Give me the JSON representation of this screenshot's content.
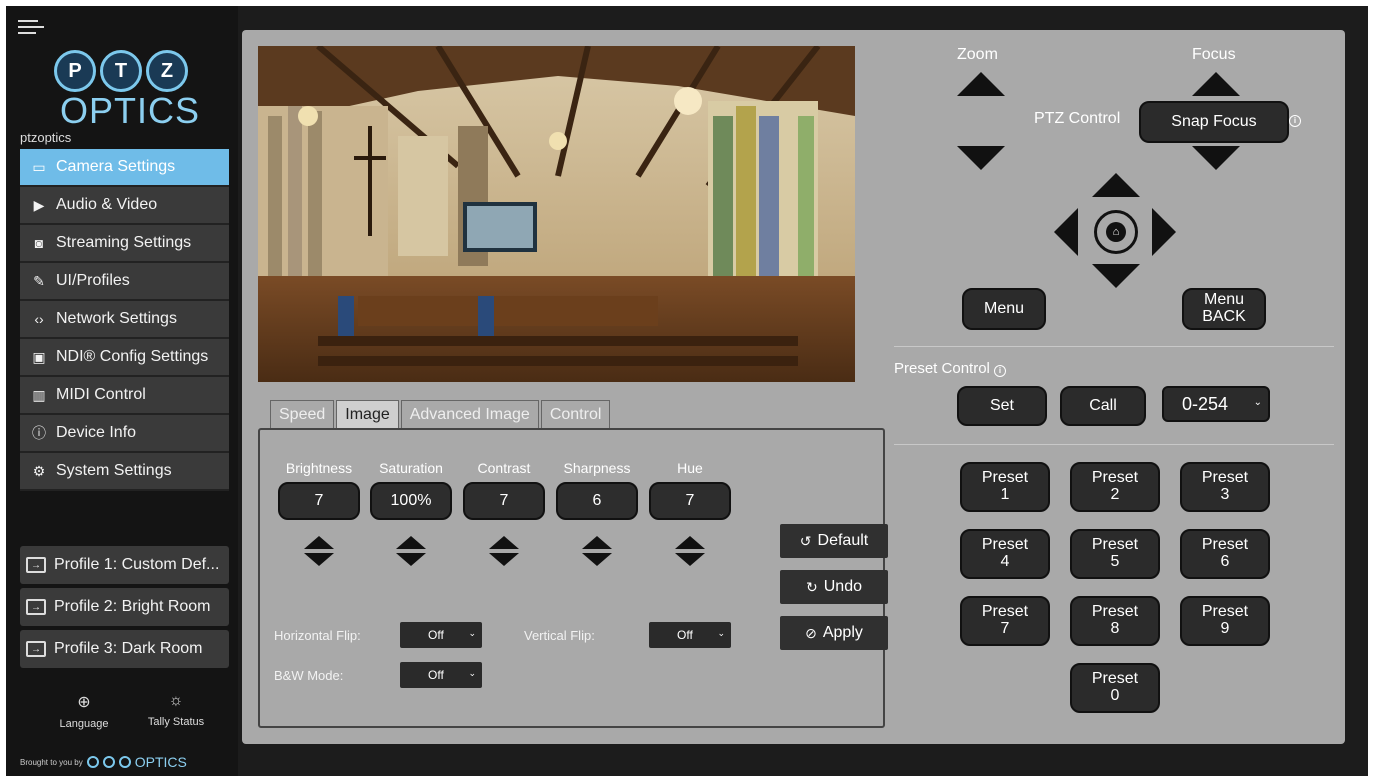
{
  "sidebar": {
    "logo_letters": [
      "P",
      "T",
      "Z"
    ],
    "logo_word": "OPTICS",
    "brand": "ptzoptics",
    "nav": [
      {
        "label": "Camera Settings",
        "icon": "camera-icon",
        "active": true
      },
      {
        "label": "Audio & Video",
        "icon": "audio-video-icon",
        "active": false
      },
      {
        "label": "Streaming Settings",
        "icon": "streaming-icon",
        "active": false
      },
      {
        "label": "UI/Profiles",
        "icon": "palette-icon",
        "active": false
      },
      {
        "label": "Network Settings",
        "icon": "network-icon",
        "active": false
      },
      {
        "label": "NDI® Config Settings",
        "icon": "ndi-icon",
        "active": false
      },
      {
        "label": "MIDI Control",
        "icon": "midi-icon",
        "active": false
      },
      {
        "label": "Device Info",
        "icon": "info-icon",
        "active": false
      },
      {
        "label": "System Settings",
        "icon": "gear-icon",
        "active": false
      }
    ],
    "profiles": [
      {
        "label": "Profile 1: Custom Def..."
      },
      {
        "label": "Profile 2: Bright Room"
      },
      {
        "label": "Profile 3: Dark Room"
      }
    ],
    "language_label": "Language",
    "tally_label": "Tally Status",
    "brought_by": "Brought to you by",
    "brought_word": "OPTICS"
  },
  "tabs": [
    {
      "label": "Speed",
      "active": false
    },
    {
      "label": "Image",
      "active": true
    },
    {
      "label": "Advanced Image",
      "active": false
    },
    {
      "label": "Control",
      "active": false
    }
  ],
  "image_controls": [
    {
      "label": "Brightness",
      "value": "7"
    },
    {
      "label": "Saturation",
      "value": "100%"
    },
    {
      "label": "Contrast",
      "value": "7"
    },
    {
      "label": "Sharpness",
      "value": "6"
    },
    {
      "label": "Hue",
      "value": "7"
    }
  ],
  "image_buttons": {
    "default_label": "Default",
    "undo_label": "Undo",
    "apply_label": "Apply"
  },
  "flips": {
    "horizontal_label": "Horizontal Flip:",
    "horizontal_value": "Off",
    "vertical_label": "Vertical Flip:",
    "vertical_value": "Off",
    "bw_label": "B&W Mode:",
    "bw_value": "Off"
  },
  "ptz": {
    "zoom_label": "Zoom",
    "focus_label": "Focus",
    "ptz_control_label": "PTZ Control",
    "snap_focus_label": "Snap Focus",
    "menu_label": "Menu",
    "menu_back_label": "Menu BACK"
  },
  "preset_control": {
    "label": "Preset Control",
    "set_label": "Set",
    "call_label": "Call",
    "range_value": "0-254",
    "presets": [
      {
        "label": "Preset",
        "num": "1"
      },
      {
        "label": "Preset",
        "num": "2"
      },
      {
        "label": "Preset",
        "num": "3"
      },
      {
        "label": "Preset",
        "num": "4"
      },
      {
        "label": "Preset",
        "num": "5"
      },
      {
        "label": "Preset",
        "num": "6"
      },
      {
        "label": "Preset",
        "num": "7"
      },
      {
        "label": "Preset",
        "num": "8"
      },
      {
        "label": "Preset",
        "num": "9"
      },
      {
        "label": "Preset",
        "num": "0"
      }
    ]
  }
}
